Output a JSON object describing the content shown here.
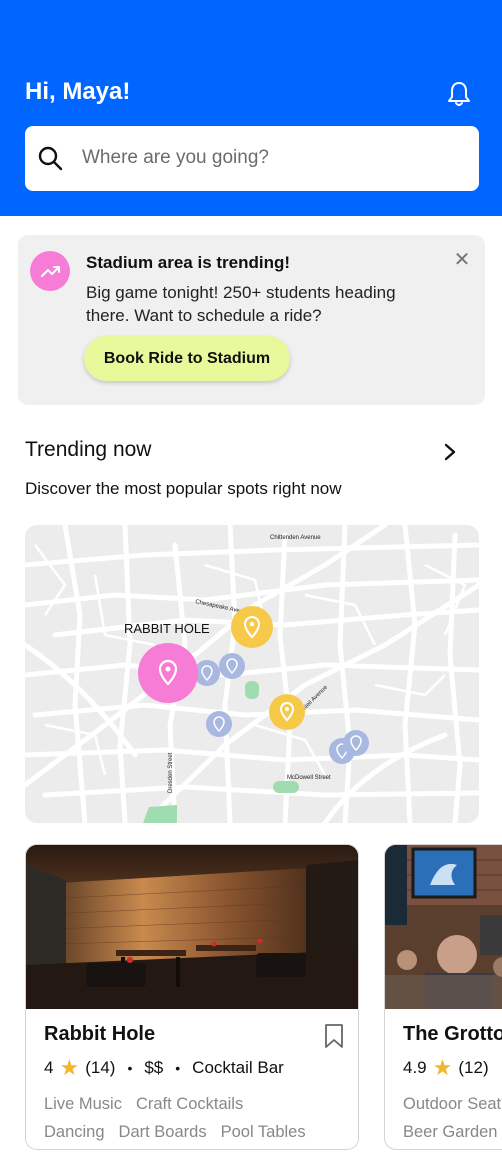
{
  "header": {
    "greeting": "Hi, Maya!",
    "search_placeholder": "Where are you going?",
    "bg_color": "#0066ff",
    "icons": [
      "bell-icon",
      "search-icon"
    ]
  },
  "banner": {
    "title": "Stadium area is trending!",
    "body": "Big game tonight! 250+ students heading there. Want to schedule a ride?",
    "button": "Book Ride to Stadium",
    "icons": [
      "trending-up-icon",
      "close-icon"
    ],
    "accent_color": "#f77cd6",
    "button_color": "#e7f99a"
  },
  "trending": {
    "title": "Trending now",
    "subtitle": "Discover the most popular spots right now"
  },
  "map": {
    "streets": [
      "Chittenden Avenue",
      "Chesapeake Ave",
      "Neil Avenue",
      "Dresden Street",
      "McDowell Street"
    ],
    "highlight_label": "RABBIT HOLE",
    "pin_colors": {
      "selected": "#f77cd6",
      "trending": "#f7c948",
      "other": "#a8b8e0"
    }
  },
  "cards": [
    {
      "name": "Rabbit Hole",
      "rating": "4",
      "reviews": "(14)",
      "price": "$$",
      "category": "Cocktail Bar",
      "tags_row1": [
        "Live Music",
        "Craft Cocktails"
      ],
      "tags_row2": [
        "Dancing",
        "Dart Boards",
        "Pool Tables"
      ]
    },
    {
      "name": "The Grotto",
      "rating": "4.9",
      "reviews": "(12)",
      "tags_row1": [
        "Outdoor Seat"
      ],
      "tags_row2": [
        "Beer Garden"
      ]
    }
  ]
}
